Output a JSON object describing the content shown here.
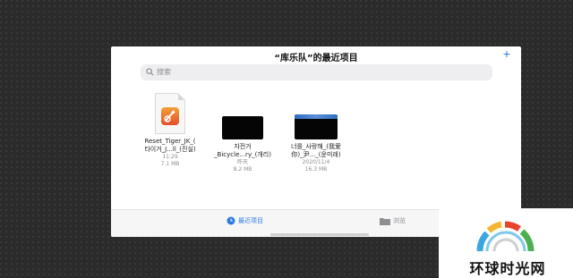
{
  "header": {
    "title": "“库乐队”的最近项目",
    "add_label": "+"
  },
  "search": {
    "placeholder": "搜索"
  },
  "files": [
    {
      "name_line1": "Reset_Tiger_JK_(",
      "name_line2": "타이거_J...ll_(진실)",
      "time": "11:29",
      "size": "7.1 MB"
    },
    {
      "name_line1": "자전거",
      "name_line2": "_Bicycle...ry_(개리)",
      "time": "昨天",
      "size": "8.2 MB"
    },
    {
      "name_line1": "너를_사랑해_(我爱",
      "name_line2": "你)_尹..._(윤미래)",
      "time": "2020/11/4",
      "size": "16.3 MB"
    }
  ],
  "tabs": [
    {
      "label": "最近项目",
      "icon": "clock-icon",
      "active": true
    },
    {
      "label": "浏览",
      "icon": "folder-icon",
      "active": false
    }
  ],
  "watermark": {
    "text": "环球时光网"
  },
  "colors": {
    "accent": "#2c7be5",
    "background": "#2b2b2b"
  }
}
